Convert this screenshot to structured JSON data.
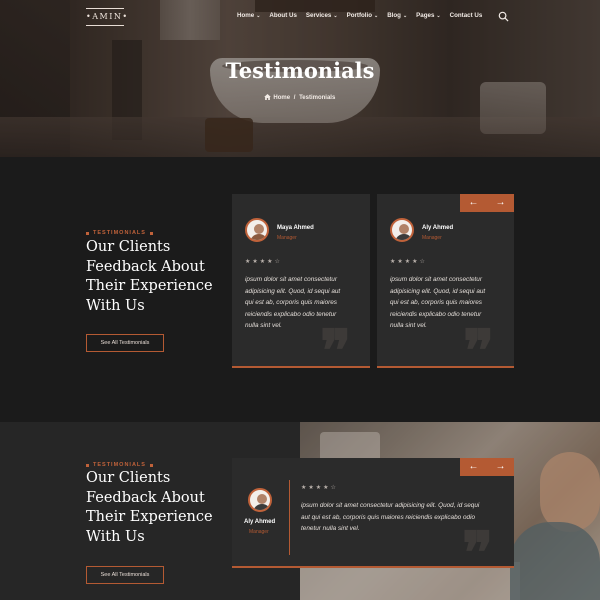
{
  "nav": {
    "logo": "AMIN",
    "items": [
      {
        "label": "Home",
        "dropdown": true
      },
      {
        "label": "About Us",
        "dropdown": false
      },
      {
        "label": "Services",
        "dropdown": true
      },
      {
        "label": "Portfolio",
        "dropdown": true
      },
      {
        "label": "Blog",
        "dropdown": true
      },
      {
        "label": "Pages",
        "dropdown": true
      },
      {
        "label": "Contact Us",
        "dropdown": false
      }
    ],
    "chevron": "⌄"
  },
  "hero": {
    "title": "Testimonials",
    "breadcrumb": {
      "home": "Home",
      "separator": "/",
      "current": "Testimonials"
    }
  },
  "section1": {
    "eyebrow": "TESTIMONIALS",
    "heading": [
      "Our Clients",
      "Feedback About",
      "Their Experience",
      "With Us"
    ],
    "cta": "See All Testimonials",
    "arrows": {
      "prev": "←",
      "next": "→"
    },
    "cards": [
      {
        "name": "Maya Ahmed",
        "role": "Manager",
        "stars": "★★★★☆",
        "quote": [
          "ipsum dolor sit amet consectetur",
          "adipisicing elit. Quod, id sequi aut",
          "qui est ab, corporis quis maiores",
          "reiciendis explicabo odio tenetur",
          "nulla sint vel."
        ]
      },
      {
        "name": "Aly Ahmed",
        "role": "Manager",
        "stars": "★★★★☆",
        "quote": [
          "ipsum dolor sit amet consectetur",
          "adipisicing elit. Quod, id sequi aut",
          "qui est ab, corporis quis maiores",
          "reiciendis explicabo odio tenetur",
          "nulla sint vel."
        ]
      }
    ]
  },
  "section2": {
    "eyebrow": "TESTIMONIALS",
    "heading": [
      "Our Clients",
      "Feedback About",
      "Their Experience",
      "With Us"
    ],
    "cta": "See All Testimonials",
    "arrows": {
      "prev": "←",
      "next": "→"
    },
    "card": {
      "name": "Aly Ahmed",
      "role": "Manager",
      "stars": "★★★★☆",
      "quote": [
        "ipsum dolor sit amet consectetur adipisicing elit. Quod, id sequi",
        "aut qui est ab, corporis quis maiores reiciendis explicabo odio",
        "tenetur nulla sint vel."
      ]
    }
  },
  "colors": {
    "accent": "#b45a33",
    "background": "#1b1b1b",
    "card": "#2b2b2b"
  },
  "quote_glyph": "❞"
}
